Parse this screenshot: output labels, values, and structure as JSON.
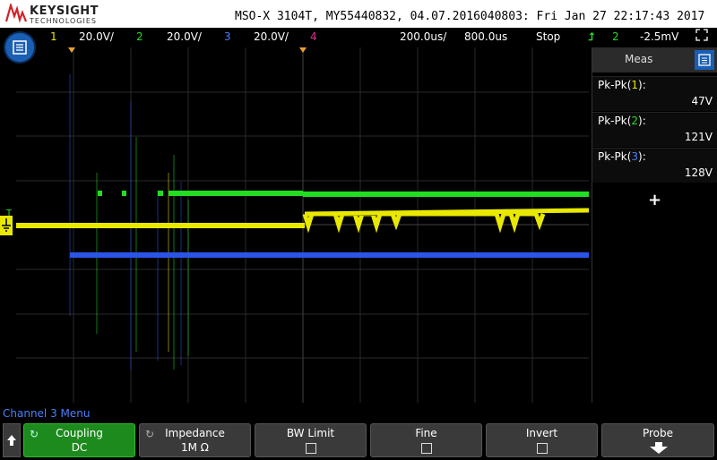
{
  "brand": {
    "name": "KEYSIGHT",
    "sub": "TECHNOLOGIES"
  },
  "header": {
    "title": "MSO-X 3104T, MY55440832, 04.07.2016040803: Fri Jan 27 22:17:43 2017"
  },
  "status": {
    "ch1_num": "1",
    "ch1_scale": "20.0V/",
    "ch2_num": "2",
    "ch2_scale": "20.0V/",
    "ch3_num": "3",
    "ch3_scale": "20.0V/",
    "ch4_num": "4",
    "timebase": "200.0us/",
    "delay": "800.0us",
    "run_state": "Stop",
    "trig_source": "2",
    "trig_level": "-2.5mV"
  },
  "measurements": {
    "title": "Meas",
    "items": [
      {
        "label": "Pk-Pk(",
        "ch": "1",
        "close": "):",
        "value": "47V",
        "color": "#e8e800"
      },
      {
        "label": "Pk-Pk(",
        "ch": "2",
        "close": "):",
        "value": "121V",
        "color": "#22dd22"
      },
      {
        "label": "Pk-Pk(",
        "ch": "3",
        "close": "):",
        "value": "128V",
        "color": "#4a7fff"
      }
    ],
    "add": "+"
  },
  "menu_title": "Channel 3 Menu",
  "softkeys": {
    "coupling": {
      "label": "Coupling",
      "value": "DC"
    },
    "impedance": {
      "label": "Impedance",
      "value": "1M Ω"
    },
    "bw_limit": {
      "label": "BW Limit"
    },
    "fine": {
      "label": "Fine"
    },
    "invert": {
      "label": "Invert"
    },
    "probe": {
      "label": "Probe"
    }
  },
  "colors": {
    "ch1": "#e8e800",
    "ch2": "#22dd22",
    "ch3": "#2a55e8",
    "ch4": "#e03090",
    "accent": "#1a5fb4"
  }
}
